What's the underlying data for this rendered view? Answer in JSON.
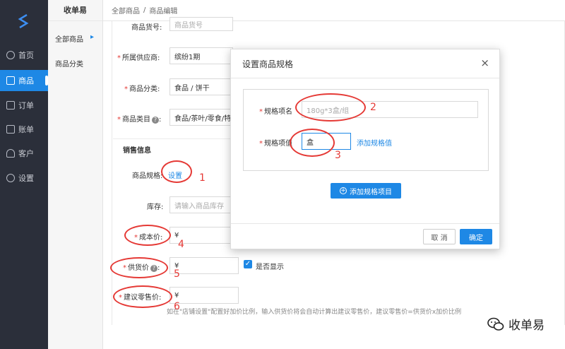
{
  "nav": {
    "items": [
      {
        "label": "首页",
        "icon": "dashboard-icon"
      },
      {
        "label": "商品",
        "icon": "edit-icon"
      },
      {
        "label": "订单",
        "icon": "order-icon"
      },
      {
        "label": "账单",
        "icon": "bill-icon"
      },
      {
        "label": "客户",
        "icon": "user-icon"
      },
      {
        "label": "设置",
        "icon": "settings-icon"
      }
    ]
  },
  "subnav": {
    "brand": "收单易",
    "items": [
      {
        "label": "全部商品"
      },
      {
        "label": "商品分类"
      }
    ],
    "arrow": "▸"
  },
  "breadcrumb": {
    "parent": "全部商品",
    "sep": "/",
    "current": "商品编辑"
  },
  "form": {
    "item_no_label": "商品货号:",
    "item_no_placeholder": "商品货号",
    "supplier_label": "所属供应商:",
    "supplier_value": "缤纷1期",
    "category_label": "商品分类:",
    "category_value": "食品 / 饼干",
    "type_label": "商品类目",
    "type_value": "食品/茶叶/零食/特",
    "sales_title": "销售信息",
    "spec_label": "商品规格:",
    "spec_link": "设置",
    "stock_label": "库存:",
    "stock_placeholder": "请输入商品库存",
    "cost_label": "成本价:",
    "cost_value": "¥",
    "supply_label": "供货价",
    "supply_value": "¥",
    "show_label": "是否显示",
    "retail_label": "建议零售价:",
    "retail_value": "¥",
    "hint": "如在\"店铺设置\"配置好加价比例，输入供货价将会自动计算出建议零售价，建议零售价=供货价x加价比例"
  },
  "modal": {
    "title": "设置商品规格",
    "close": "×",
    "spec_name_label": "规格项名",
    "spec_name_placeholder": "180g*3盒/组",
    "spec_value_label": "规格项值",
    "spec_value": "盒",
    "add_value_link": "添加规格值",
    "add_item_button": "添加规格项目",
    "cancel": "取 消",
    "confirm": "确定"
  },
  "annotations": [
    "1",
    "2",
    "3",
    "4",
    "5",
    "6"
  ],
  "watermark": "收单易",
  "colors": {
    "nav_bg": "#2b2f3a",
    "accent": "#1e88e5",
    "annotation": "#e53935"
  }
}
